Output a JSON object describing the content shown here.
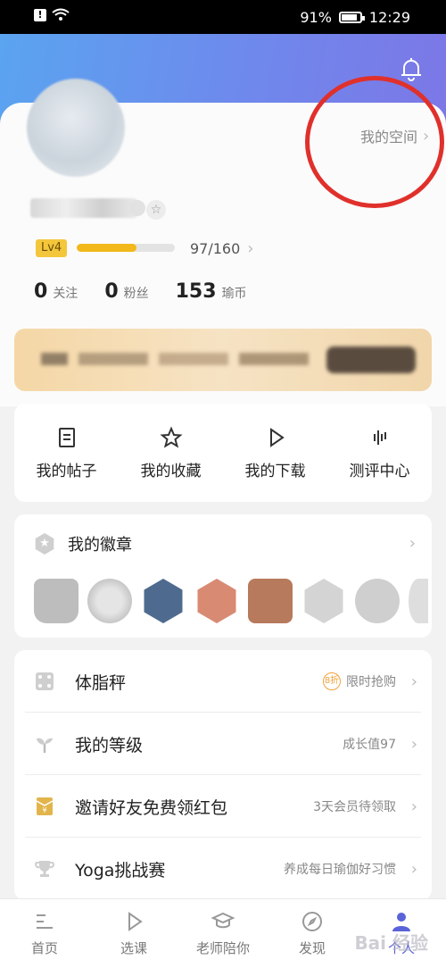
{
  "status_bar": {
    "battery": "91%",
    "time": "12:29"
  },
  "profile": {
    "space_link": "我的空间",
    "level_badge": "Lv4",
    "level_progress_text": "97/160",
    "level_progress_fraction": 0.606,
    "stats": [
      {
        "value": "0",
        "label": "关注"
      },
      {
        "value": "0",
        "label": "粉丝"
      },
      {
        "value": "153",
        "label": "瑜币"
      }
    ]
  },
  "actions": [
    {
      "label": "我的帖子",
      "icon": "document-icon"
    },
    {
      "label": "我的收藏",
      "icon": "star-icon"
    },
    {
      "label": "我的下载",
      "icon": "play-icon"
    },
    {
      "label": "测评中心",
      "icon": "bars-icon"
    }
  ],
  "badges_section": {
    "title": "我的徽章"
  },
  "menu": [
    {
      "label": "体脂秤",
      "extra": "限时抢购",
      "extra_icon": "8折",
      "icon": "dice-icon"
    },
    {
      "label": "我的等级",
      "extra": "成长值97",
      "icon": "sprout-icon"
    },
    {
      "label": "邀请好友免费领红包",
      "extra": "3天会员待领取",
      "icon": "red-envelope-icon"
    },
    {
      "label": "Yoga挑战赛",
      "extra": "养成每日瑜伽好习惯",
      "icon": "trophy-icon"
    }
  ],
  "tabbar": [
    {
      "label": "首页",
      "icon": "home-icon"
    },
    {
      "label": "选课",
      "icon": "play-icon"
    },
    {
      "label": "老师陪你",
      "icon": "graduation-cap-icon"
    },
    {
      "label": "发现",
      "icon": "compass-icon"
    },
    {
      "label": "个人",
      "icon": "person-icon"
    }
  ],
  "watermark": "Bai 经验",
  "colors": {
    "accent": "#5a63d8",
    "level_fill": "#f3b819",
    "annotation_red": "#e0302b"
  }
}
